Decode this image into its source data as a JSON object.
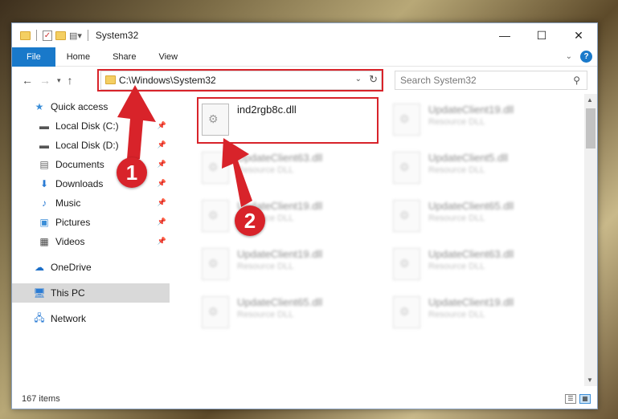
{
  "window": {
    "title": "System32"
  },
  "ribbon": {
    "tabs": [
      "File",
      "Home",
      "Share",
      "View"
    ]
  },
  "address": {
    "path": "C:\\Windows\\System32",
    "search_placeholder": "Search System32"
  },
  "sidebar": {
    "items": [
      {
        "label": "Quick access",
        "icon": "star-icon"
      },
      {
        "label": "Local Disk (C:)",
        "icon": "drive-icon",
        "pinned": true
      },
      {
        "label": "Local Disk (D:)",
        "icon": "drive-icon",
        "pinned": true
      },
      {
        "label": "Documents",
        "icon": "documents-icon",
        "pinned": true
      },
      {
        "label": "Downloads",
        "icon": "download-icon",
        "pinned": true
      },
      {
        "label": "Music",
        "icon": "music-icon",
        "pinned": true
      },
      {
        "label": "Pictures",
        "icon": "pictures-icon",
        "pinned": true
      },
      {
        "label": "Videos",
        "icon": "videos-icon",
        "pinned": true
      },
      {
        "label": "OneDrive",
        "icon": "cloud-icon"
      },
      {
        "label": "This PC",
        "icon": "computer-icon",
        "selected": true
      },
      {
        "label": "Network",
        "icon": "network-icon"
      }
    ]
  },
  "files": [
    {
      "name": "ind2rgb8c.dll",
      "type": ""
    },
    {
      "name": "UpdateClient19.dll",
      "type": "Resource DLL"
    },
    {
      "name": "UpdateClient63.dll",
      "type": "Resource DLL"
    },
    {
      "name": "UpdateClient5.dll",
      "type": "Resource DLL"
    },
    {
      "name": "UpdateClient19.dll",
      "type": "Resource DLL"
    },
    {
      "name": "UpdateClient65.dll",
      "type": "Resource DLL"
    },
    {
      "name": "UpdateClient19.dll",
      "type": "Resource DLL"
    },
    {
      "name": "UpdateClient63.dll",
      "type": "Resource DLL"
    },
    {
      "name": "UpdateClient65.dll",
      "type": "Resource DLL"
    },
    {
      "name": "UpdateClient19.dll",
      "type": "Resource DLL"
    }
  ],
  "status": {
    "count": "167 items"
  },
  "annotations": {
    "step1": "1",
    "step2": "2",
    "color": "#d8232a"
  }
}
